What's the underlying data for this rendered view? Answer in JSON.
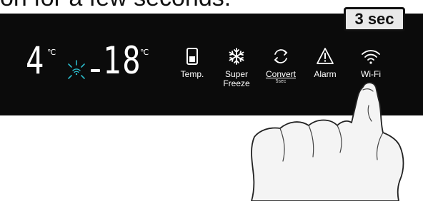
{
  "caption": "on for a few seconds.",
  "display": {
    "fridge_temp": "4",
    "fridge_unit": "℃",
    "freezer_temp": "18",
    "freezer_unit": "℃"
  },
  "buttons": [
    {
      "id": "temp",
      "label": "Temp.",
      "icon": "thermometer-icon"
    },
    {
      "id": "super-freeze",
      "label": "Super Freeze",
      "icon": "snowflake-icon"
    },
    {
      "id": "convert",
      "label": "Convert",
      "sub": "5sec",
      "icon": "convert-icon"
    },
    {
      "id": "alarm",
      "label": "Alarm",
      "icon": "alarm-icon"
    },
    {
      "id": "wifi",
      "label": "Wi-Fi",
      "icon": "wifi-icon"
    }
  ],
  "badge": "3 sec",
  "colors": {
    "panel": "#0b0b0b",
    "wifi_indicator": "#2ab8c8",
    "badge_bg": "#e9e9e9"
  }
}
